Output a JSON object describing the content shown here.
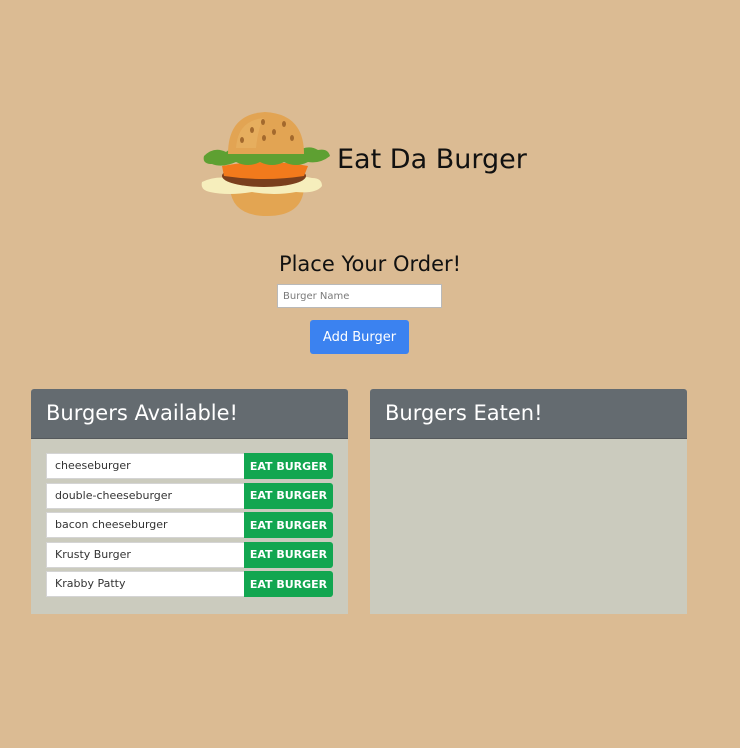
{
  "header": {
    "title": "Eat Da Burger",
    "logo_icon": "burger-icon"
  },
  "order": {
    "heading": "Place Your Order!",
    "input_placeholder": "Burger Name",
    "input_value": "",
    "add_button_label": "Add Burger"
  },
  "available": {
    "title": "Burgers Available!",
    "eat_button_label": "EAT BURGER",
    "items": [
      {
        "name": "cheeseburger"
      },
      {
        "name": "double-cheeseburger"
      },
      {
        "name": "bacon cheeseburger"
      },
      {
        "name": "Krusty Burger"
      },
      {
        "name": "Krabby Patty"
      }
    ]
  },
  "eaten": {
    "title": "Burgers Eaten!",
    "items": []
  },
  "colors": {
    "page_background": "#dbbb93",
    "panel_header": "#646b70",
    "panel_body": "#cbcbbe",
    "add_button": "#3b82f0",
    "eat_button": "#12a650"
  }
}
